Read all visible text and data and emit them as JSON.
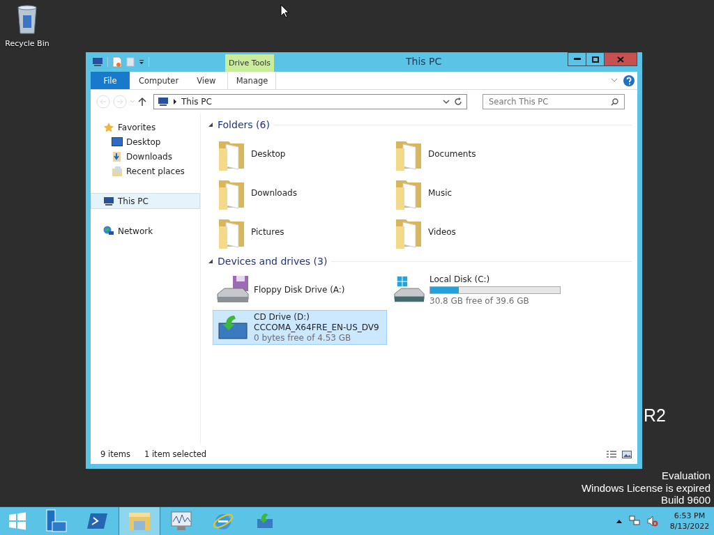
{
  "desktop": {
    "icons": [
      {
        "label": "Recycle Bin"
      }
    ],
    "watermark": [
      "R2",
      "Evaluation",
      "Windows License is expired",
      "Build 9600"
    ]
  },
  "window": {
    "title": "This PC",
    "context_tab": "Drive Tools",
    "tabs": [
      {
        "label": "File",
        "kind": "file",
        "selected": false
      },
      {
        "label": "Computer",
        "kind": "tab",
        "selected": false
      },
      {
        "label": "View",
        "kind": "tab",
        "selected": false
      },
      {
        "label": "Manage",
        "kind": "context",
        "selected": false
      }
    ],
    "address": [
      "This PC"
    ],
    "search": {
      "placeholder": "Search This PC"
    }
  },
  "nav": [
    {
      "label": "Favorites",
      "kind": "star",
      "selected": false,
      "children": [
        {
          "label": "Desktop",
          "kind": "desktop",
          "selected": false
        },
        {
          "label": "Downloads",
          "kind": "downloads",
          "selected": false
        },
        {
          "label": "Recent places",
          "kind": "recent",
          "selected": false
        }
      ]
    },
    {
      "label": "This PC",
      "kind": "pc",
      "selected": true
    },
    {
      "label": "Network",
      "kind": "network",
      "selected": false
    }
  ],
  "groups": [
    {
      "title": "Folders (6)",
      "expanded": true,
      "items": [
        {
          "kind": "folder",
          "name": "Desktop",
          "selected": false
        },
        {
          "kind": "folder",
          "name": "Documents",
          "selected": false
        },
        {
          "kind": "folder",
          "name": "Downloads",
          "selected": false
        },
        {
          "kind": "folder",
          "name": "Music",
          "selected": false
        },
        {
          "kind": "folder",
          "name": "Pictures",
          "selected": false
        },
        {
          "kind": "folder",
          "name": "Videos",
          "selected": false
        }
      ]
    },
    {
      "title": "Devices and drives (3)",
      "expanded": true,
      "items": [
        {
          "kind": "floppy",
          "name": "Floppy Disk Drive (A:)",
          "selected": false
        },
        {
          "kind": "disk",
          "name": "Local Disk (C:)",
          "level": 0.22,
          "free": "30.8 GB free of 39.6 GB",
          "selected": false
        },
        {
          "kind": "cd",
          "name": "CD Drive (D:)",
          "label": "CCCOMA_X64FRE_EN-US_DV9",
          "free": "0 bytes free of 4.53 GB",
          "selected": true
        }
      ]
    }
  ],
  "status_bar": {
    "count": "9 items",
    "selection": "1 item selected"
  },
  "taskbar": {
    "apps": [
      {
        "kind": "server",
        "active": false
      },
      {
        "kind": "powershell",
        "active": false
      },
      {
        "kind": "explorer",
        "active": true
      },
      {
        "kind": "monitor",
        "active": false
      },
      {
        "kind": "ie",
        "active": false
      },
      {
        "kind": "cd",
        "active": false
      }
    ],
    "time": "6:53 PM",
    "date": "8/13/2022"
  }
}
